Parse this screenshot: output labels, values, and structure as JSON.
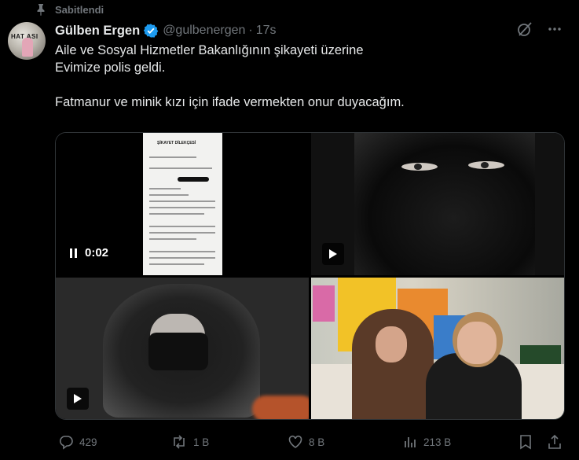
{
  "pinned": {
    "label": "Sabitlendi"
  },
  "tweet": {
    "author": {
      "name": "Gülben Ergen",
      "handle": "@gulbenergen",
      "time": "17s",
      "separator": "·",
      "avatar_text": "HAT ASI"
    },
    "text": [
      "Aile ve Sosyal Hizmetler Bakanlığının şikayeti üzerine",
      "Evimize polis geldi.",
      "",
      "Fatmanur ve minik kızı için ifade vermekten onur duyacağım."
    ],
    "media": {
      "video_time": "0:02",
      "document_title": "ŞİKAYET DİLEKÇESİ"
    },
    "actions": {
      "replies": "429",
      "reposts": "1 B",
      "likes": "8 B",
      "views": "213 B"
    }
  },
  "colors": {
    "background": "#000000",
    "text_primary": "#e7e9ea",
    "text_secondary": "#71767b",
    "verified": "#1d9bf0"
  }
}
